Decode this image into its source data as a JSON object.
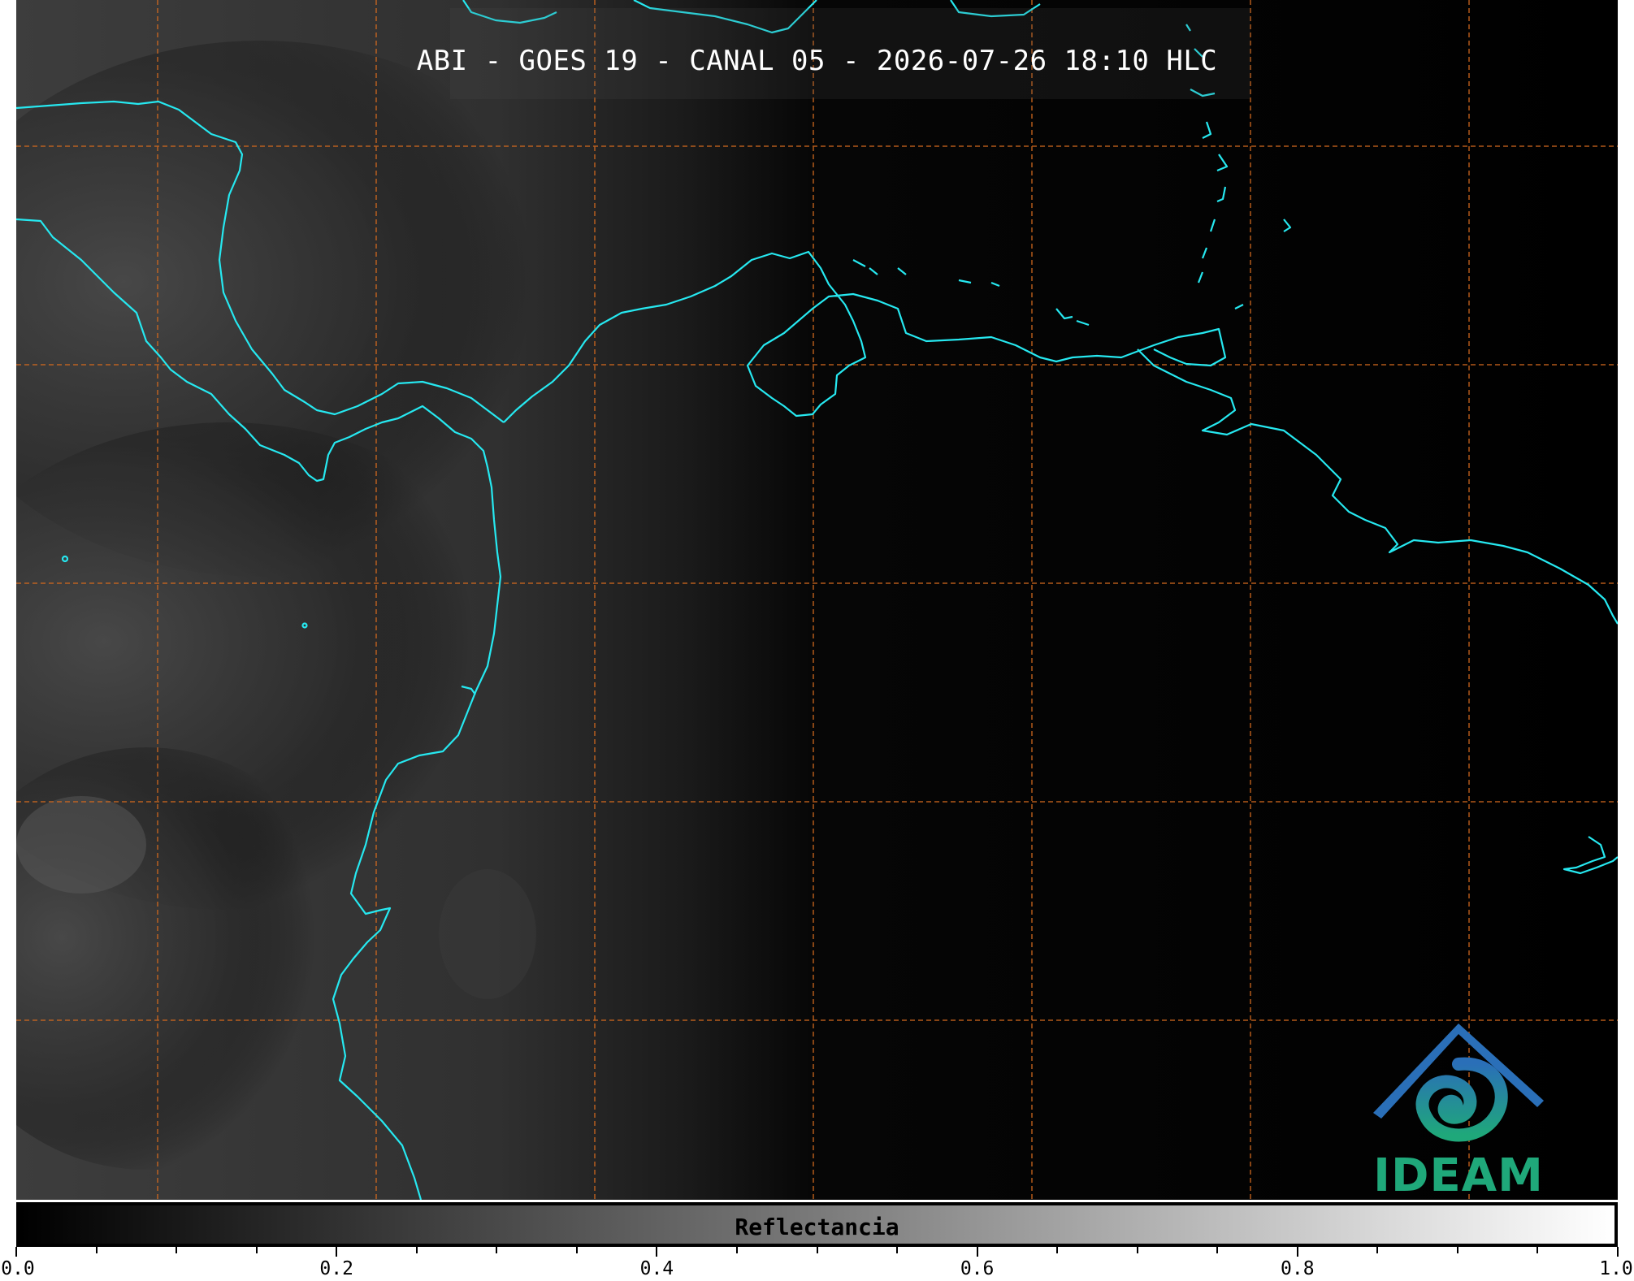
{
  "title": "ABI - GOES 19 - CANAL 05 - 2026-07-26 18:10 HLC",
  "colorbar": {
    "label": "Reflectancia",
    "min": 0.0,
    "max": 1.0,
    "tick_labels": [
      "0.0",
      "0.2",
      "0.4",
      "0.6",
      "0.8",
      "1.0"
    ]
  },
  "logo": {
    "text": "IDEAM"
  },
  "colors": {
    "coastline": "#26e8f0",
    "gridline": "#d2691e",
    "background": "#000000",
    "logo_blue": "#2a6fb8",
    "logo_green": "#1fa87a"
  }
}
